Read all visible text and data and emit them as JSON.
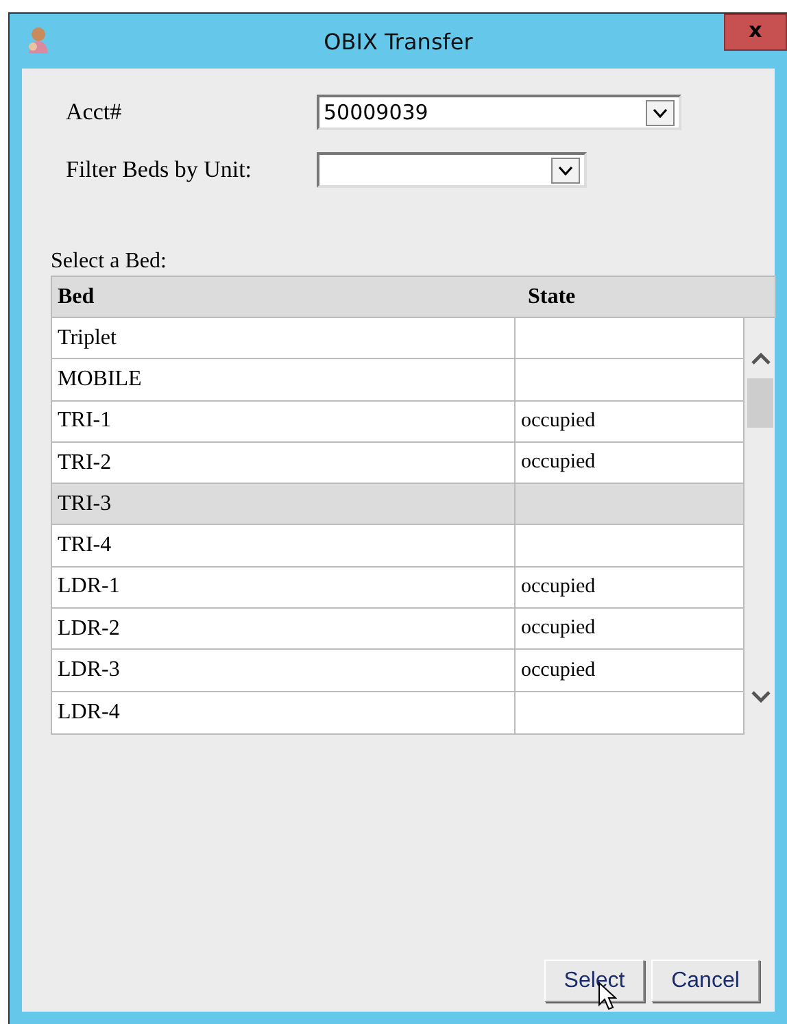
{
  "window": {
    "title": "OBIX Transfer",
    "close": "x"
  },
  "fields": [
    {
      "label": "Acct#",
      "value": "50009039",
      "kind": "wide"
    },
    {
      "label": "Filter Beds by Unit:",
      "kind": "narrow"
    }
  ],
  "table": {
    "caption": "Select a Bed:",
    "columns": [
      "Bed",
      "State"
    ],
    "rows": [
      {
        "bed": "Triplet",
        "selected": false
      },
      {
        "bed": "MOBILE",
        "selected": false
      },
      {
        "bed": "TRI-1",
        "state": "occupied",
        "selected": false
      },
      {
        "bed": "TRI-2",
        "state": "occupied",
        "selected": false
      },
      {
        "bed": "TRI-3",
        "selected": true
      },
      {
        "bed": "TRI-4",
        "selected": false
      },
      {
        "bed": "LDR-1",
        "state": "occupied",
        "selected": false
      },
      {
        "bed": "LDR-2",
        "state": "occupied",
        "selected": false
      },
      {
        "bed": "LDR-3",
        "state": "occupied",
        "selected": false
      },
      {
        "bed": "LDR-4",
        "selected": false
      }
    ]
  },
  "buttons": [
    "Select",
    "Cancel"
  ]
}
